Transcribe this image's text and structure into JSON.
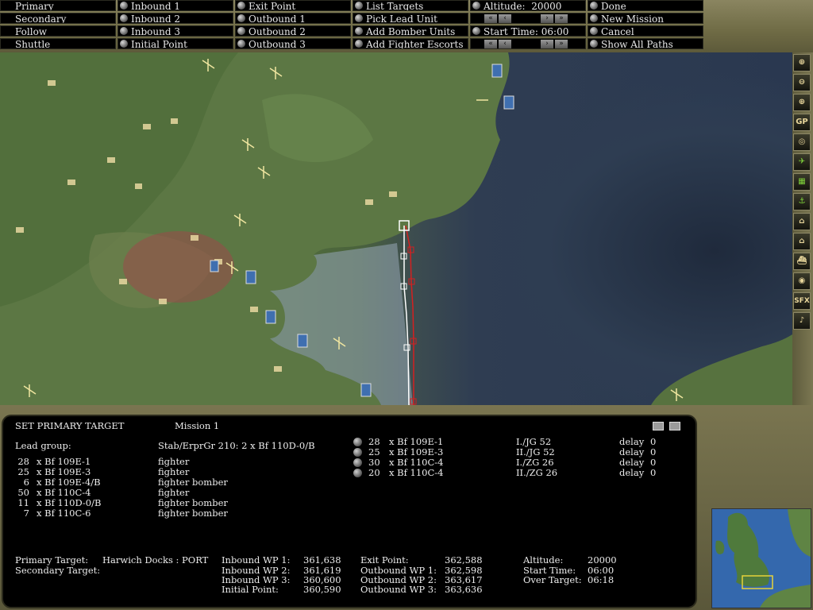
{
  "menu": {
    "col1": [
      "Primary",
      "Secondary",
      "Follow",
      "Shuttle"
    ],
    "col2": [
      "Inbound 1",
      "Inbound 2",
      "Inbound 3",
      "Initial Point"
    ],
    "col3": [
      "Exit Point",
      "Outbound 1",
      "Outbound 2",
      "Outbound 3"
    ],
    "col4": [
      "List Targets",
      "Pick Lead Unit",
      "Add Bomber Units",
      "Add Fighter Escorts"
    ],
    "altitude_label": "Altitude:",
    "altitude_value": "20000",
    "start_time_label": "Start Time:",
    "start_time_value": "06:00",
    "col6": [
      "Done",
      "New Mission",
      "Cancel",
      "Show All Paths"
    ],
    "arrow_glyphs": [
      "«",
      "‹",
      "›",
      "»"
    ]
  },
  "toolbar": {
    "tools": [
      "zoom-in",
      "zoom-out",
      "crosshair",
      "GP",
      "target",
      "flight-path",
      "airbase",
      "anchor",
      "factory",
      "port",
      "ship",
      "radar",
      "SFX",
      "♪"
    ]
  },
  "panel": {
    "title": "SET PRIMARY TARGET",
    "mission": "Mission 1",
    "lead_group_label": "Lead group:",
    "lead_unit": "Stab/ErprGr 210:  2 x Bf 110D-0/B",
    "lead_rows": [
      {
        "count": "28",
        "type": "x Bf 109E-1",
        "role": "fighter"
      },
      {
        "count": "25",
        "type": "x Bf 109E-3",
        "role": "fighter"
      },
      {
        "count": "6",
        "type": "x Bf 109E-4/B",
        "role": "fighter bomber"
      },
      {
        "count": "50",
        "type": "x Bf 110C-4",
        "role": "fighter"
      },
      {
        "count": "11",
        "type": "x Bf 110D-0/B",
        "role": "fighter bomber"
      },
      {
        "count": "7",
        "type": "x Bf 110C-6",
        "role": "fighter bomber"
      }
    ],
    "escorts": [
      {
        "count": "28",
        "type": "x Bf 109E-1",
        "unit": "I./JG 52",
        "delay_label": "delay",
        "delay": "0"
      },
      {
        "count": "25",
        "type": "x Bf 109E-3",
        "unit": "II./JG 52",
        "delay_label": "delay",
        "delay": "0"
      },
      {
        "count": "30",
        "type": "x Bf 110C-4",
        "unit": "I./ZG 26",
        "delay_label": "delay",
        "delay": "0"
      },
      {
        "count": "20",
        "type": "x Bf 110C-4",
        "unit": "II./ZG 26",
        "delay_label": "delay",
        "delay": "0"
      }
    ],
    "primary_target_label": "Primary Target:",
    "primary_target": "Harwich Docks : PORT",
    "secondary_target_label": "Secondary Target:",
    "waypoints_a": [
      {
        "label": "Inbound WP 1:",
        "value": "361,638"
      },
      {
        "label": "Inbound WP 2:",
        "value": "361,619"
      },
      {
        "label": "Inbound WP 3:",
        "value": "360,600"
      },
      {
        "label": "Initial Point:",
        "value": "360,590"
      }
    ],
    "waypoints_b": [
      {
        "label": "Exit Point:",
        "value": "362,588"
      },
      {
        "label": "Outbound WP 1:",
        "value": "362,598"
      },
      {
        "label": "Outbound WP 2:",
        "value": "363,617"
      },
      {
        "label": "Outbound WP 3:",
        "value": "363,636"
      }
    ],
    "summary": [
      {
        "label": "Altitude:",
        "value": "20000"
      },
      {
        "label": "Start Time:",
        "value": "06:00"
      },
      {
        "label": "Over Target:",
        "value": "06:18"
      }
    ]
  },
  "colors": {
    "route_white": "#ffffff",
    "route_red": "#d42020",
    "button_bg": "#000000",
    "text": "#ececec"
  }
}
